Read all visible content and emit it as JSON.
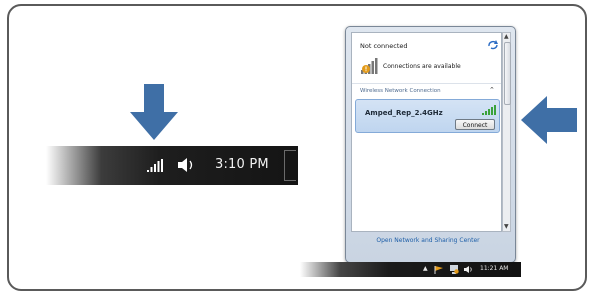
{
  "colors": {
    "arrow": "#3f6fa6",
    "frame_border": "#5a5a5a",
    "link": "#1e5fa8",
    "signal_green": "#3aa23a",
    "warning_orange": "#e39b1b"
  },
  "left_taskbar": {
    "clock": "3:10 PM",
    "icons": [
      "network-signal-icon",
      "speaker-icon"
    ]
  },
  "popup": {
    "status": "Not connected",
    "available_text": "Connections are available",
    "section_title": "Wireless Network Connection",
    "network": {
      "name": "Amped_Rep_2.4GHz",
      "connect_label": "Connect"
    },
    "footer_link": "Open Network and Sharing Center"
  },
  "bottom_taskbar": {
    "clock": "11:21 AM",
    "icons": [
      "show-hidden-icons-icon",
      "action-center-flag-icon",
      "network-icon",
      "speaker-icon"
    ]
  }
}
